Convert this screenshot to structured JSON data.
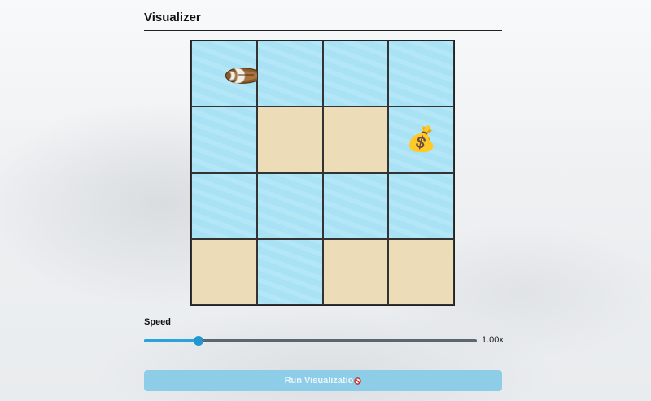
{
  "header": {
    "title": "Visualizer"
  },
  "grid": {
    "rows": 4,
    "cols": 4,
    "cells": [
      [
        "water",
        "water",
        "water",
        "water"
      ],
      [
        "water",
        "sand",
        "sand",
        "water"
      ],
      [
        "water",
        "water",
        "water",
        "water"
      ],
      [
        "sand",
        "water",
        "sand",
        "sand"
      ]
    ],
    "boat": {
      "row": 0,
      "col": 0,
      "icon": "boat-icon"
    },
    "treasure": {
      "row": 1,
      "col": 3,
      "icon": "money-bag-icon",
      "glyph": "💰"
    },
    "colors": {
      "water": "#a9e2f5",
      "sand": "#ecdcb8"
    }
  },
  "speed": {
    "label": "Speed",
    "value_text": "1.00x",
    "level_fraction": 0.165
  },
  "run": {
    "label": "Run Visualizatio",
    "cursor_icon": "not-allowed-icon"
  }
}
